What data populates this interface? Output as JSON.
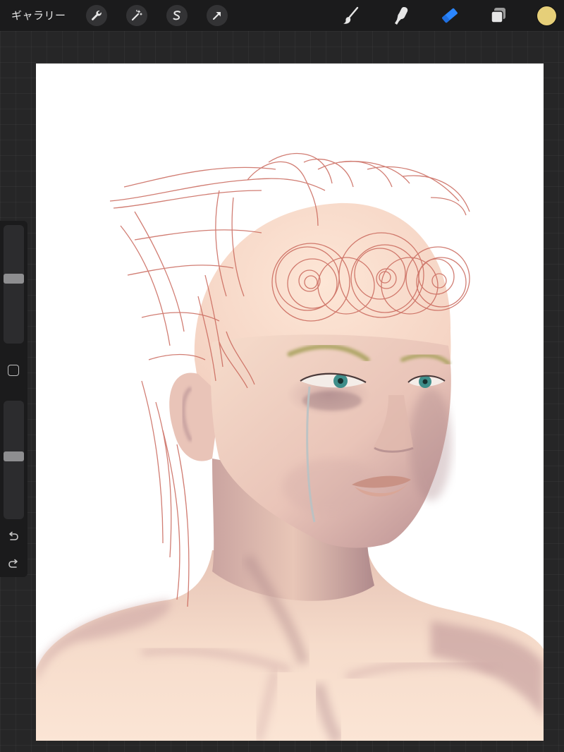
{
  "toolbar": {
    "gallery_label": "ギャラリー",
    "left_tools": [
      {
        "name": "actions",
        "icon": "wrench-icon"
      },
      {
        "name": "adjustments",
        "icon": "magic-wand-icon"
      },
      {
        "name": "selection",
        "icon": "selection-s-icon"
      },
      {
        "name": "transform",
        "icon": "arrow-cursor-icon"
      }
    ],
    "right_tools": [
      {
        "name": "brush",
        "icon": "brush-icon",
        "active": false
      },
      {
        "name": "smudge",
        "icon": "smudge-finger-icon",
        "active": false
      },
      {
        "name": "eraser",
        "icon": "eraser-icon",
        "active": true
      },
      {
        "name": "layers",
        "icon": "layers-icon",
        "active": false
      }
    ],
    "current_color": "#e6cf79",
    "active_tool_color": "#2b86ff"
  },
  "sidebar": {
    "brush_size_level": 0.55,
    "opacity_level": 0.53,
    "controls": [
      "modify-square-icon",
      "undo-icon",
      "redo-icon"
    ]
  }
}
